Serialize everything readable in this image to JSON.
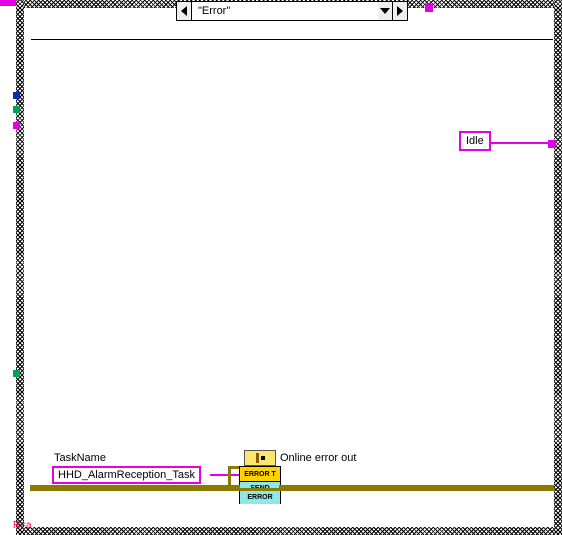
{
  "case_selector": {
    "current": "\"Error\""
  },
  "idle": {
    "text": "Idle"
  },
  "taskname": {
    "label": "TaskName",
    "value": "HHD_AlarmReception_Task"
  },
  "bundle_out_label": "Online error out",
  "subvi": {
    "top": "ERROR T",
    "bottom": "SEND ERROR"
  },
  "red_marker": "R=a"
}
